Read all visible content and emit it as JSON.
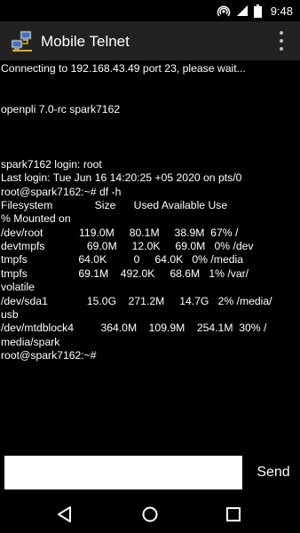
{
  "status_bar": {
    "time": "9:48",
    "icons": [
      "hotspot-icon",
      "signal-icon",
      "battery-icon"
    ]
  },
  "app_bar": {
    "title": "Mobile Telnet",
    "icon": "network-computers-icon",
    "menu_icon": "overflow-menu-icon"
  },
  "terminal": {
    "lines": [
      "Connecting to 192.168.43.49 port 23, please wait...",
      "",
      "",
      "openpli 7.0-rc spark7162",
      "",
      "",
      "",
      "spark7162 login: root",
      "Last login: Tue Jun 16 14:20:25 +05 2020 on pts/0",
      "root@spark7162:~# df -h",
      "Filesystem              Size      Used Available Use",
      "% Mounted on",
      "/dev/root            119.0M     80.1M     38.9M  67% /",
      "devtmpfs              69.0M     12.0K     69.0M   0% /dev",
      "tmpfs                 64.0K         0     64.0K   0% /media",
      "tmpfs                 69.1M    492.0K     68.6M   1% /var/",
      "volatile",
      "/dev/sda1             15.0G    271.2M     14.7G   2% /media/",
      "usb",
      "/dev/mtdblock4         364.0M    109.9M    254.1M  30% /",
      "media/spark",
      "root@spark7162:~#"
    ]
  },
  "input": {
    "value": "",
    "placeholder": ""
  },
  "send_label": "Send",
  "nav": {
    "back": "back-icon",
    "home": "home-icon",
    "recents": "recents-icon"
  },
  "colors": {
    "background": "#000000",
    "appbar": "#212121",
    "text": "#ffffff"
  }
}
